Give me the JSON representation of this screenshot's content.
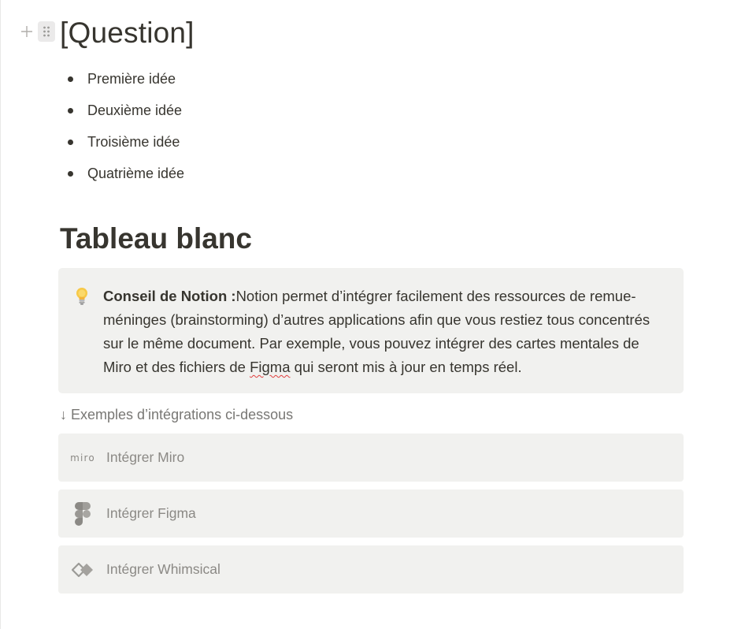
{
  "page": {
    "title": "[Question]",
    "bullets": [
      "Première idée",
      "Deuxième idée",
      "Troisième idée",
      "Quatrième idée"
    ],
    "section_heading": "Tableau blanc",
    "callout": {
      "icon": "lightbulb-icon",
      "bold_label": "Conseil de Notion :",
      "text_before": "Notion permet d’intégrer facilement des ressources de remue-méninges (brainstorming) d’autres applications afin que vous restiez tous concentrés sur le même document. Par exemple, vous pouvez intégrer des cartes mentales de Miro et des fichiers de ",
      "spell_word": "Figma",
      "text_after": " qui seront mis à jour en temps réel."
    },
    "caption": "↓ Exemples d’intégrations ci-dessous",
    "embeds": [
      {
        "icon": "miro-icon",
        "icon_text": "miro",
        "label": "Intégrer Miro"
      },
      {
        "icon": "figma-icon",
        "label": "Intégrer Figma"
      },
      {
        "icon": "whimsical-icon",
        "label": "Intégrer Whimsical"
      }
    ]
  },
  "colors": {
    "text": "#37352f",
    "muted": "#787774",
    "callout_bg": "#f1f1ef",
    "spell_underline": "#e03e3e"
  }
}
